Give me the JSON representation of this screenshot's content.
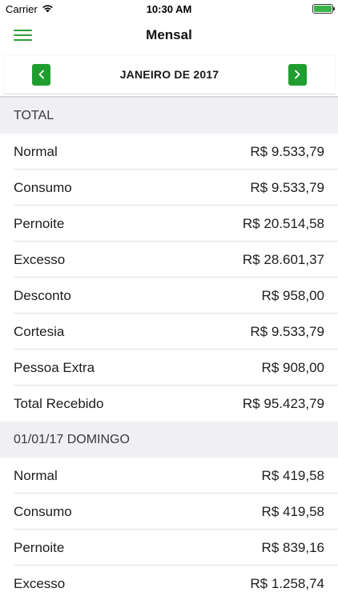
{
  "status_bar": {
    "carrier": "Carrier",
    "time": "10:30 AM"
  },
  "nav": {
    "title": "Mensal"
  },
  "month_selector": {
    "label": "JANEIRO DE 2017"
  },
  "sections": [
    {
      "title": "TOTAL",
      "rows": [
        {
          "label": "Normal",
          "value": "R$ 9.533,79"
        },
        {
          "label": "Consumo",
          "value": "R$ 9.533,79"
        },
        {
          "label": "Pernoite",
          "value": "R$ 20.514,58"
        },
        {
          "label": "Excesso",
          "value": "R$ 28.601,37"
        },
        {
          "label": "Desconto",
          "value": "R$ 958,00"
        },
        {
          "label": "Cortesia",
          "value": "R$ 9.533,79"
        },
        {
          "label": "Pessoa Extra",
          "value": "R$ 908,00"
        },
        {
          "label": "Total Recebido",
          "value": "R$ 95.423,79"
        }
      ]
    },
    {
      "title": "01/01/17 DOMINGO",
      "rows": [
        {
          "label": "Normal",
          "value": "R$ 419,58"
        },
        {
          "label": "Consumo",
          "value": "R$ 419,58"
        },
        {
          "label": "Pernoite",
          "value": "R$ 839,16"
        },
        {
          "label": "Excesso",
          "value": "R$ 1.258,74"
        }
      ]
    }
  ],
  "colors": {
    "accent": "#1f9e2f",
    "section_bg": "#efeff4"
  }
}
